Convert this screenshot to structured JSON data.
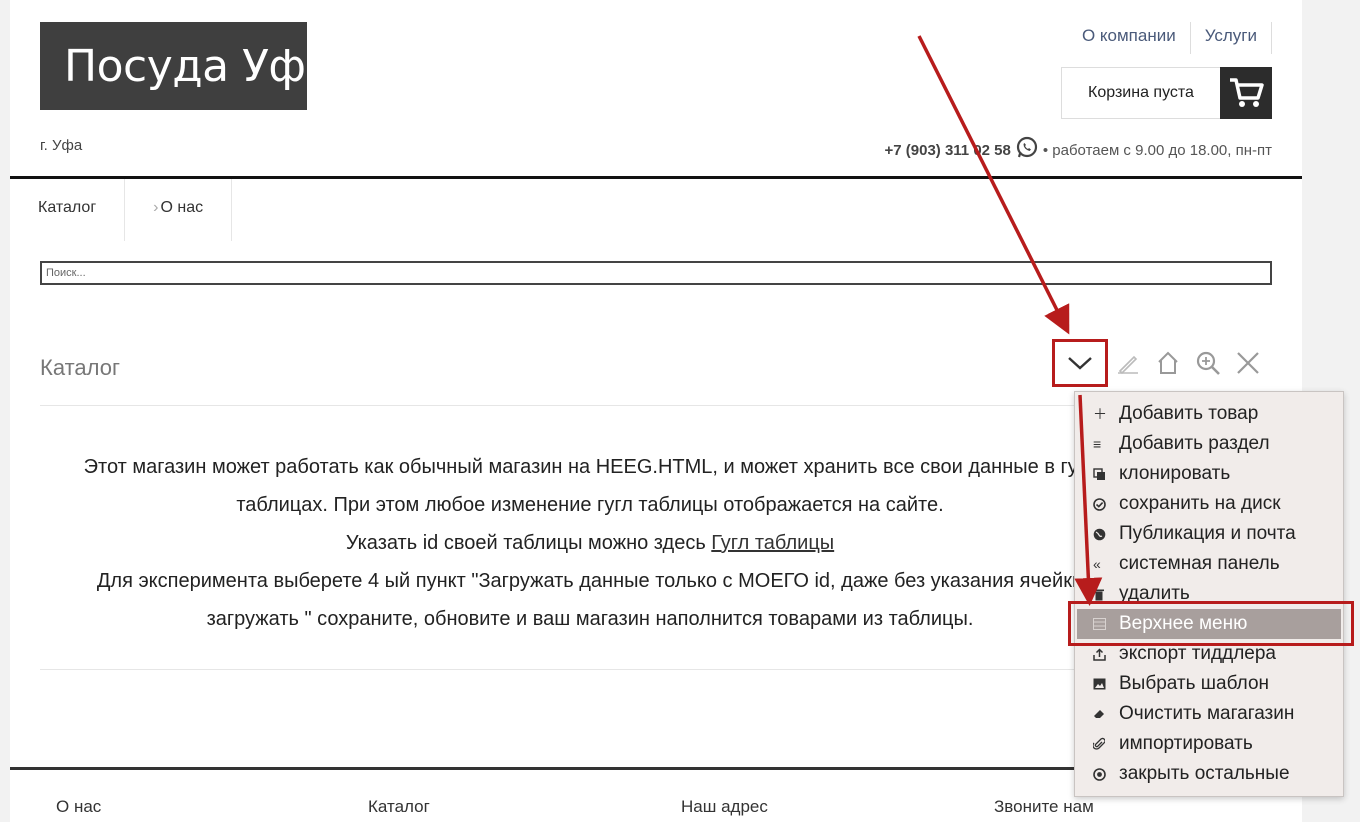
{
  "header": {
    "logo": "Посуда Уф",
    "city": "г. Уфа",
    "top_links": [
      "О компании",
      "Услуги"
    ],
    "cart_label": "Корзина пуста",
    "phone": "+7 (903) 311 02 58",
    "hours": "• работаем с 9.00 до 18.00, пн-пт"
  },
  "nav": {
    "catalog": "Каталог",
    "about": "О нас"
  },
  "search": {
    "placeholder": "Поиск..."
  },
  "section": {
    "title": "Каталог"
  },
  "content": {
    "line1": "Этот магазин может работать как обычный магазин на HEEG.HTML, и может хранить все свои данные в гугл",
    "line2": "таблицах. При этом любое изменение гугл таблицы отображается на сайте.",
    "line3_prefix": "Указать id своей таблицы можно здесь ",
    "line3_link": "Гугл таблицы",
    "line4": "Для эксперимента выберете 4 ый пункт \"Загружать данные только с МОЕГО id, даже без указания ячейки",
    "line5": "загружать \" сохраните, обновите и ваш магазин наполнится товарами из таблицы."
  },
  "menu": {
    "items": [
      {
        "label": "Добавить товар",
        "icon": "plus"
      },
      {
        "label": "Добавить раздел",
        "icon": "lines"
      },
      {
        "label": "клонировать",
        "icon": "clone"
      },
      {
        "label": "сохранить на диск",
        "icon": "check-circle"
      },
      {
        "label": "Публикация и почта",
        "icon": "globe"
      },
      {
        "label": "системная панель",
        "icon": "double-chevron-left"
      },
      {
        "label": "удалить",
        "icon": "trash"
      },
      {
        "label": "Верхнее меню",
        "icon": "panel"
      },
      {
        "label": "экспорт тиддлера",
        "icon": "export"
      },
      {
        "label": "Выбрать шаблон",
        "icon": "image"
      },
      {
        "label": "Очистить магагазин",
        "icon": "eraser"
      },
      {
        "label": "импортировать",
        "icon": "paperclip"
      },
      {
        "label": "закрыть остальные",
        "icon": "target"
      }
    ],
    "highlighted": "Верхнее меню"
  },
  "footer": {
    "col1": "О нас",
    "col2": "Каталог",
    "col3": "Наш адрес",
    "col4": "Звоните нам"
  },
  "colors": {
    "accent": "#b71c1c",
    "highlight": "#a89f9d",
    "logo_bg": "#3f3f3f"
  }
}
